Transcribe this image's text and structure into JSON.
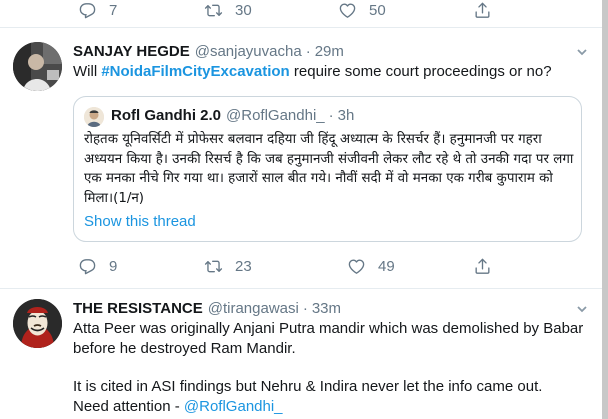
{
  "top_tweet_actions": {
    "replies": "7",
    "retweets": "30",
    "likes": "50"
  },
  "tweet_sanjay": {
    "name": "SANJAY HEGDE",
    "handle": "@sanjayuvacha",
    "separator": "·",
    "time": "29m",
    "text_before": "Will ",
    "hashtag": "#NoidaFilmCityExcavation",
    "text_after": " require some court proceedings or no?",
    "quote": {
      "name": "Rofl Gandhi 2.0",
      "handle": "@RoflGandhi_",
      "separator": "·",
      "time": "3h",
      "text": "रोहतक यूनिवर्सिटी में प्रोफेसर बलवान दहिया जी हिंदू अध्यात्म के रिसर्चर हैं। हनुमानजी पर गहरा अध्ययन किया है। उनकी रिसर्च है कि जब हनुमानजी संजीवनी लेकर लौट रहे थे तो उनकी गदा पर लगा एक मनका नीचे गिर गया था। हजारों साल बीत गये। नौवीं सदी में वो मनका एक गरीब कुपाराम को मिला।(1/न)",
      "show_thread": "Show this thread"
    },
    "actions": {
      "replies": "9",
      "retweets": "23",
      "likes": "49"
    }
  },
  "tweet_resistance": {
    "name": "THE RESISTANCE",
    "handle": "@tirangawasi",
    "separator": "·",
    "time": "33m",
    "line1": "Atta Peer was originally Anjani Putra mandir which was demolished by Babar",
    "line2": "before he destroyed Ram Mandir.",
    "line3": "It is cited in ASI findings but Nehru & Indira never let the info came out.",
    "line4_prefix": "Need attention - ",
    "mention": "@RoflGandhi_"
  },
  "icons": [
    "reply-icon",
    "retweet-icon",
    "like-icon",
    "share-icon",
    "chevron-down-icon"
  ]
}
